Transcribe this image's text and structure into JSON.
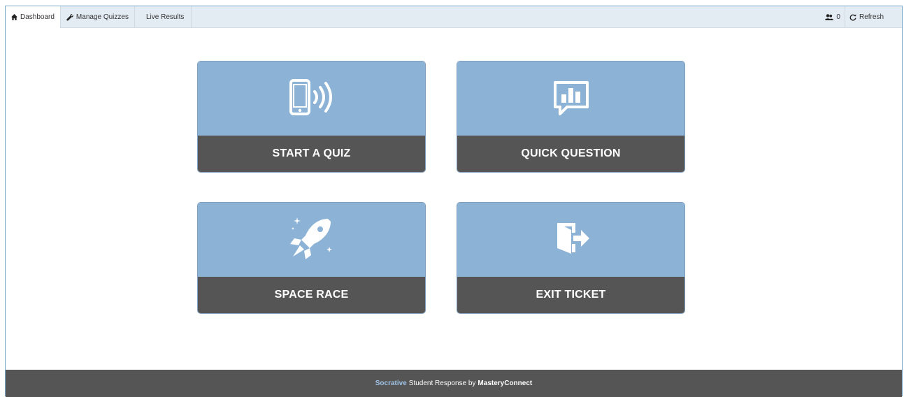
{
  "nav": {
    "tabs": [
      {
        "label": "Dashboard",
        "icon": "home-icon"
      },
      {
        "label": "Manage Quizzes",
        "icon": "wrench-icon"
      },
      {
        "label": "Live Results",
        "icon": ""
      }
    ],
    "students_count": "0",
    "refresh_label": "Refresh"
  },
  "cards": [
    {
      "label": "START A QUIZ",
      "icon": "mobile-wireless-icon"
    },
    {
      "label": "QUICK QUESTION",
      "icon": "chat-chart-icon"
    },
    {
      "label": "SPACE RACE",
      "icon": "rocket-icon"
    },
    {
      "label": "EXIT TICKET",
      "icon": "exit-door-icon"
    }
  ],
  "footer": {
    "brand": "Socrative",
    "middle": "Student Response by",
    "company": "MasteryConnect"
  },
  "colors": {
    "card_top": "#8cb2d5",
    "card_bottom": "#555555",
    "footer_bg": "#555555",
    "brand_accent": "#9fc3e6"
  }
}
